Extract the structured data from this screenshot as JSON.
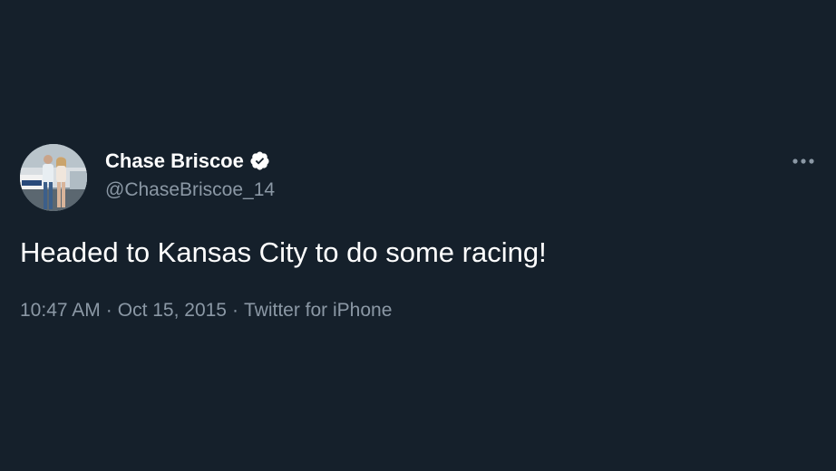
{
  "tweet": {
    "author": {
      "name": "Chase Briscoe",
      "handle": "@ChaseBriscoe_14",
      "verified": true
    },
    "text": "Headed to Kansas City to do some racing!",
    "meta": {
      "time": "10:47 AM",
      "separator": "·",
      "date": "Oct 15, 2015",
      "source": "Twitter for iPhone"
    },
    "icons": {
      "verified": "verified-badge-icon",
      "more": "more-options-icon"
    }
  },
  "colors": {
    "background": "#15202b",
    "primary_text": "#ffffff",
    "secondary_text": "#8b98a5"
  }
}
